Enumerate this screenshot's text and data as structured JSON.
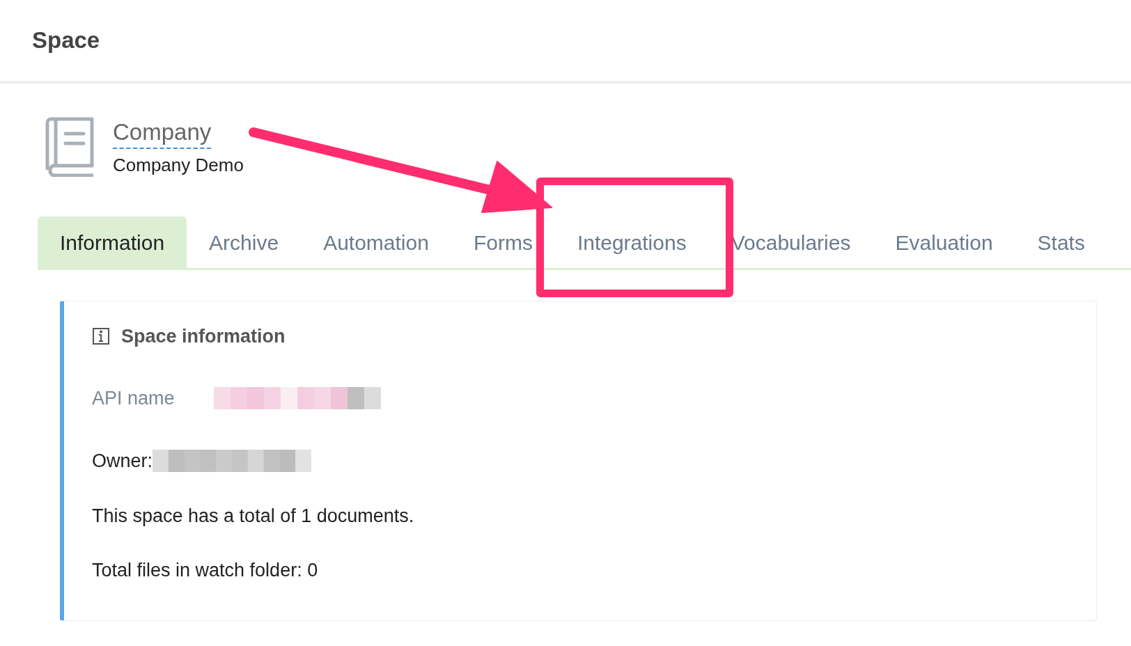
{
  "header": {
    "title": "Space"
  },
  "space": {
    "name": "Company",
    "description": "Company Demo"
  },
  "tabs": [
    {
      "label": "Information",
      "selected": true
    },
    {
      "label": "Archive",
      "selected": false
    },
    {
      "label": "Automation",
      "selected": false
    },
    {
      "label": "Forms",
      "selected": false
    },
    {
      "label": "Integrations",
      "selected": false
    },
    {
      "label": "Vocabularies",
      "selected": false
    },
    {
      "label": "Evaluation",
      "selected": false
    },
    {
      "label": "Stats",
      "selected": false
    }
  ],
  "card": {
    "title": "Space information",
    "api_label": "API name",
    "owner_label": "Owner:",
    "lines": [
      "This space has a total of 1 documents.",
      "Total files in watch folder: 0"
    ]
  }
}
